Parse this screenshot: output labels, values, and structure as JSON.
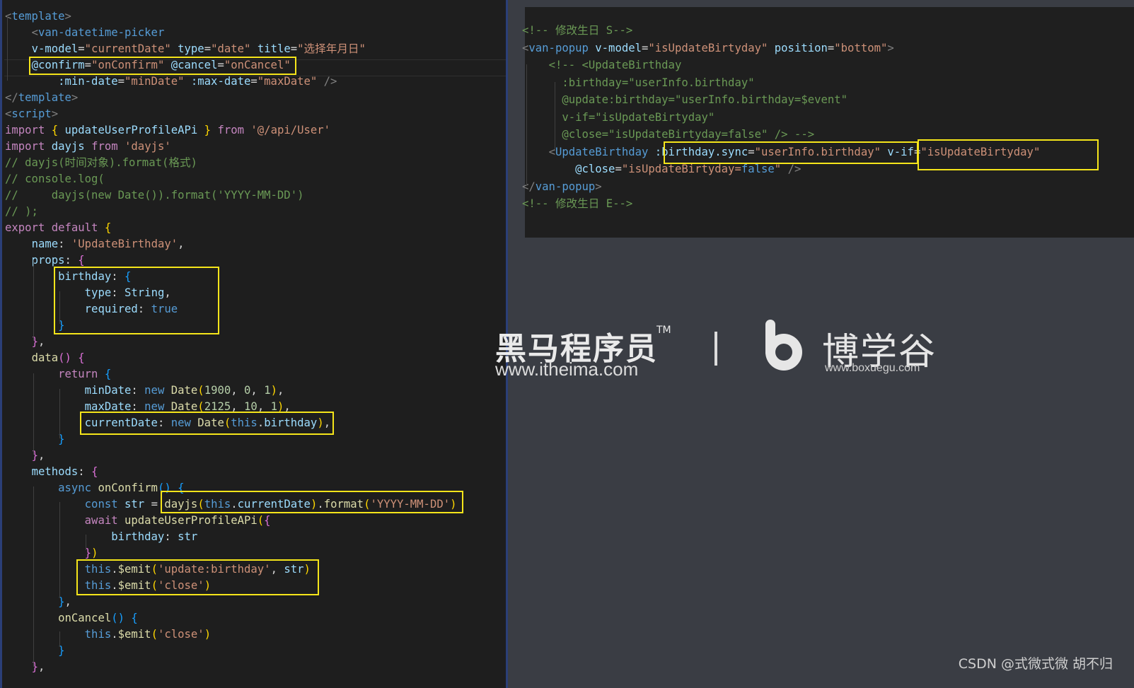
{
  "left_editor": {
    "lines": [
      [
        [
          "punc",
          "<"
        ],
        [
          "tag",
          "template"
        ],
        [
          "punc",
          ">"
        ]
      ],
      [
        [
          "t",
          "    "
        ],
        [
          "punc",
          "<"
        ],
        [
          "tag",
          "van-datetime-picker"
        ]
      ],
      [
        [
          "t",
          "    "
        ],
        [
          "attr",
          "v-model"
        ],
        [
          "t",
          "="
        ],
        [
          "str",
          "\"currentDate\""
        ],
        [
          "t",
          " "
        ],
        [
          "attr",
          "type"
        ],
        [
          "t",
          "="
        ],
        [
          "str",
          "\"date\""
        ],
        [
          "t",
          " "
        ],
        [
          "attr",
          "title"
        ],
        [
          "t",
          "="
        ],
        [
          "str",
          "\"选择年月日\""
        ]
      ],
      [
        [
          "t",
          "    "
        ],
        [
          "attr",
          "@confirm"
        ],
        [
          "t",
          "="
        ],
        [
          "str",
          "\"onConfirm\""
        ],
        [
          "t",
          " "
        ],
        [
          "attr",
          "@cancel"
        ],
        [
          "t",
          "="
        ],
        [
          "str",
          "\"onCancel\""
        ]
      ],
      [
        [
          "t",
          "        "
        ],
        [
          "attr",
          ":min-date"
        ],
        [
          "t",
          "="
        ],
        [
          "str",
          "\"minDate\""
        ],
        [
          "t",
          " "
        ],
        [
          "attr",
          ":max-date"
        ],
        [
          "t",
          "="
        ],
        [
          "str",
          "\"maxDate\""
        ],
        [
          "t",
          " "
        ],
        [
          "punc",
          "/>"
        ]
      ],
      [
        [
          "punc",
          "</"
        ],
        [
          "tag",
          "template"
        ],
        [
          "punc",
          ">"
        ]
      ],
      [
        [
          "punc",
          "<"
        ],
        [
          "tag",
          "script"
        ],
        [
          "punc",
          ">"
        ]
      ],
      [
        [
          "kw",
          "import"
        ],
        [
          "t",
          " "
        ],
        [
          "br1",
          "{"
        ],
        [
          "t",
          " "
        ],
        [
          "attr",
          "updateUserProfileAPi"
        ],
        [
          "t",
          " "
        ],
        [
          "br1",
          "}"
        ],
        [
          "t",
          " "
        ],
        [
          "kw",
          "from"
        ],
        [
          "t",
          " "
        ],
        [
          "str",
          "'@/api/User'"
        ]
      ],
      [
        [
          "kw",
          "import"
        ],
        [
          "t",
          " "
        ],
        [
          "attr",
          "dayjs"
        ],
        [
          "t",
          " "
        ],
        [
          "kw",
          "from"
        ],
        [
          "t",
          " "
        ],
        [
          "str",
          "'dayjs'"
        ]
      ],
      [
        [
          "cm",
          "// dayjs(时间对象).format(格式)"
        ]
      ],
      [
        [
          "cm",
          "// console.log("
        ]
      ],
      [
        [
          "cm",
          "//     dayjs(new Date()).format('YYYY-MM-DD')"
        ]
      ],
      [
        [
          "cm",
          "// );"
        ]
      ],
      [
        [
          "kw",
          "export"
        ],
        [
          "t",
          " "
        ],
        [
          "kw",
          "default"
        ],
        [
          "t",
          " "
        ],
        [
          "br1",
          "{"
        ]
      ],
      [
        [
          "t",
          "    "
        ],
        [
          "attr",
          "name"
        ],
        [
          "t",
          ": "
        ],
        [
          "str",
          "'UpdateBirthday'"
        ],
        [
          "t",
          ","
        ]
      ],
      [
        [
          "t",
          "    "
        ],
        [
          "attr",
          "props"
        ],
        [
          "t",
          ": "
        ],
        [
          "br2",
          "{"
        ]
      ],
      [
        [
          "t",
          "        "
        ],
        [
          "attr",
          "birthday"
        ],
        [
          "t",
          ": "
        ],
        [
          "br3",
          "{"
        ]
      ],
      [
        [
          "t",
          "            "
        ],
        [
          "attr",
          "type"
        ],
        [
          "t",
          ": "
        ],
        [
          "attr",
          "String"
        ],
        [
          "t",
          ","
        ]
      ],
      [
        [
          "t",
          "            "
        ],
        [
          "attr",
          "required"
        ],
        [
          "t",
          ": "
        ],
        [
          "kw2",
          "true"
        ]
      ],
      [
        [
          "t",
          "        "
        ],
        [
          "br3",
          "}"
        ]
      ],
      [
        [
          "t",
          "    "
        ],
        [
          "br2",
          "}"
        ],
        [
          "t",
          ","
        ]
      ],
      [
        [
          "t",
          "    "
        ],
        [
          "fn",
          "data"
        ],
        [
          "br2",
          "()"
        ],
        [
          "t",
          " "
        ],
        [
          "br2",
          "{"
        ]
      ],
      [
        [
          "t",
          "        "
        ],
        [
          "kw",
          "return"
        ],
        [
          "t",
          " "
        ],
        [
          "br3",
          "{"
        ]
      ],
      [
        [
          "t",
          "            "
        ],
        [
          "attr",
          "minDate"
        ],
        [
          "t",
          ": "
        ],
        [
          "kw2",
          "new"
        ],
        [
          "t",
          " "
        ],
        [
          "fn",
          "Date"
        ],
        [
          "br1",
          "("
        ],
        [
          "num",
          "1900"
        ],
        [
          "t",
          ", "
        ],
        [
          "num",
          "0"
        ],
        [
          "t",
          ", "
        ],
        [
          "num",
          "1"
        ],
        [
          "br1",
          ")"
        ],
        [
          "t",
          ","
        ]
      ],
      [
        [
          "t",
          "            "
        ],
        [
          "attr",
          "maxDate"
        ],
        [
          "t",
          ": "
        ],
        [
          "kw2",
          "new"
        ],
        [
          "t",
          " "
        ],
        [
          "fn",
          "Date"
        ],
        [
          "br1",
          "("
        ],
        [
          "num",
          "2125"
        ],
        [
          "t",
          ", "
        ],
        [
          "num",
          "10"
        ],
        [
          "t",
          ", "
        ],
        [
          "num",
          "1"
        ],
        [
          "br1",
          ")"
        ],
        [
          "t",
          ","
        ]
      ],
      [
        [
          "t",
          "            "
        ],
        [
          "attr",
          "currentDate"
        ],
        [
          "t",
          ": "
        ],
        [
          "kw2",
          "new"
        ],
        [
          "t",
          " "
        ],
        [
          "fn",
          "Date"
        ],
        [
          "br1",
          "("
        ],
        [
          "kw2",
          "this"
        ],
        [
          "t",
          "."
        ],
        [
          "attr",
          "birthday"
        ],
        [
          "br1",
          ")"
        ],
        [
          "t",
          ","
        ]
      ],
      [
        [
          "t",
          "        "
        ],
        [
          "br3",
          "}"
        ]
      ],
      [
        [
          "t",
          "    "
        ],
        [
          "br2",
          "}"
        ],
        [
          "t",
          ","
        ]
      ],
      [
        [
          "t",
          "    "
        ],
        [
          "attr",
          "methods"
        ],
        [
          "t",
          ": "
        ],
        [
          "br2",
          "{"
        ]
      ],
      [
        [
          "t",
          "        "
        ],
        [
          "kw2",
          "async"
        ],
        [
          "t",
          " "
        ],
        [
          "fn",
          "onConfirm"
        ],
        [
          "br3",
          "()"
        ],
        [
          "t",
          " "
        ],
        [
          "br3",
          "{"
        ]
      ],
      [
        [
          "t",
          "            "
        ],
        [
          "kw2",
          "const"
        ],
        [
          "t",
          " "
        ],
        [
          "attr",
          "str"
        ],
        [
          "t",
          " = "
        ],
        [
          "fn",
          "dayjs"
        ],
        [
          "br1",
          "("
        ],
        [
          "kw2",
          "this"
        ],
        [
          "t",
          "."
        ],
        [
          "attr",
          "currentDate"
        ],
        [
          "br1",
          ")"
        ],
        [
          "t",
          "."
        ],
        [
          "fn",
          "format"
        ],
        [
          "br1",
          "("
        ],
        [
          "str",
          "'YYYY-MM-DD'"
        ],
        [
          "br1",
          ")"
        ]
      ],
      [
        [
          "t",
          "            "
        ],
        [
          "kw",
          "await"
        ],
        [
          "t",
          " "
        ],
        [
          "fn",
          "updateUserProfileAPi"
        ],
        [
          "br1",
          "("
        ],
        [
          "br2",
          "{"
        ]
      ],
      [
        [
          "t",
          "                "
        ],
        [
          "attr",
          "birthday"
        ],
        [
          "t",
          ": "
        ],
        [
          "attr",
          "str"
        ]
      ],
      [
        [
          "t",
          "            "
        ],
        [
          "br2",
          "}"
        ],
        [
          "br1",
          ")"
        ]
      ],
      [
        [
          "t",
          "            "
        ],
        [
          "kw2",
          "this"
        ],
        [
          "t",
          "."
        ],
        [
          "fn",
          "$emit"
        ],
        [
          "br1",
          "("
        ],
        [
          "str",
          "'update:birthday'"
        ],
        [
          "t",
          ", "
        ],
        [
          "attr",
          "str"
        ],
        [
          "br1",
          ")"
        ]
      ],
      [
        [
          "t",
          "            "
        ],
        [
          "kw2",
          "this"
        ],
        [
          "t",
          "."
        ],
        [
          "fn",
          "$emit"
        ],
        [
          "br1",
          "("
        ],
        [
          "str",
          "'close'"
        ],
        [
          "br1",
          ")"
        ]
      ],
      [
        [
          "t",
          "        "
        ],
        [
          "br3",
          "}"
        ],
        [
          "t",
          ","
        ]
      ],
      [
        [
          "t",
          "        "
        ],
        [
          "fn",
          "onCancel"
        ],
        [
          "br3",
          "()"
        ],
        [
          "t",
          " "
        ],
        [
          "br3",
          "{"
        ]
      ],
      [
        [
          "t",
          "            "
        ],
        [
          "kw2",
          "this"
        ],
        [
          "t",
          "."
        ],
        [
          "fn",
          "$emit"
        ],
        [
          "br1",
          "("
        ],
        [
          "str",
          "'close'"
        ],
        [
          "br1",
          ")"
        ]
      ],
      [
        [
          "t",
          "        "
        ],
        [
          "br3",
          "}"
        ]
      ],
      [
        [
          "t",
          "    "
        ],
        [
          "br2",
          "}"
        ],
        [
          "t",
          ","
        ]
      ]
    ]
  },
  "right_editor": {
    "lines": [
      [
        [
          "cm",
          "<!-- 修改生日 S-->"
        ]
      ],
      [
        [
          "punc",
          "<"
        ],
        [
          "tag",
          "van-popup"
        ],
        [
          "t",
          " "
        ],
        [
          "attr",
          "v-model"
        ],
        [
          "t",
          "="
        ],
        [
          "str",
          "\"isUpdateBirtyday\""
        ],
        [
          "t",
          " "
        ],
        [
          "attr",
          "position"
        ],
        [
          "t",
          "="
        ],
        [
          "str",
          "\"bottom\""
        ],
        [
          "punc",
          ">"
        ]
      ],
      [
        [
          "t",
          "    "
        ],
        [
          "cm",
          "<!-- <UpdateBirthday"
        ]
      ],
      [
        [
          "t",
          "      "
        ],
        [
          "cm",
          ":birthday=\"userInfo.birthday\""
        ]
      ],
      [
        [
          "t",
          "      "
        ],
        [
          "cm",
          "@update:birthday=\"userInfo.birthday=$event\""
        ]
      ],
      [
        [
          "t",
          "      "
        ],
        [
          "cm",
          "v-if=\"isUpdateBirtyday\""
        ]
      ],
      [
        [
          "t",
          "      "
        ],
        [
          "cm",
          "@close=\"isUpdateBirtyday=false\" /> -->"
        ]
      ],
      [
        [
          "t",
          "    "
        ],
        [
          "punc",
          "<"
        ],
        [
          "tag",
          "UpdateBirthday"
        ],
        [
          "t",
          " "
        ],
        [
          "attr",
          ":birthday.sync"
        ],
        [
          "t",
          "="
        ],
        [
          "str",
          "\"userInfo.birthday\""
        ],
        [
          "t",
          " "
        ],
        [
          "attr",
          "v-if"
        ],
        [
          "t",
          "="
        ],
        [
          "str",
          "\"isUpdateBirtyday\""
        ]
      ],
      [
        [
          "t",
          "        "
        ],
        [
          "attr",
          "@close"
        ],
        [
          "t",
          "="
        ],
        [
          "str",
          "\"isUpdateBirtyday="
        ],
        [
          "kw2",
          "false"
        ],
        [
          "str",
          "\""
        ],
        [
          "t",
          " "
        ],
        [
          "punc",
          "/>"
        ]
      ],
      [
        [
          "punc",
          "</"
        ],
        [
          "tag",
          "van-popup"
        ],
        [
          "punc",
          ">"
        ]
      ],
      [
        [
          "cm",
          "<!-- 修改生日 E-->"
        ]
      ]
    ]
  },
  "watermark": {
    "brand_cn": "黑马程序员",
    "tm": "TM",
    "brand_url": "www.itheima.com",
    "logo_cn": "博学谷",
    "logo_url": "www.boxuegu.com"
  },
  "footer": {
    "credit": "CSDN @式微式微   胡不归"
  },
  "colors": {
    "highlight": "#f5e51a",
    "editor_bg": "#1e1e1e",
    "desktop_bg": "#3a3d44"
  }
}
